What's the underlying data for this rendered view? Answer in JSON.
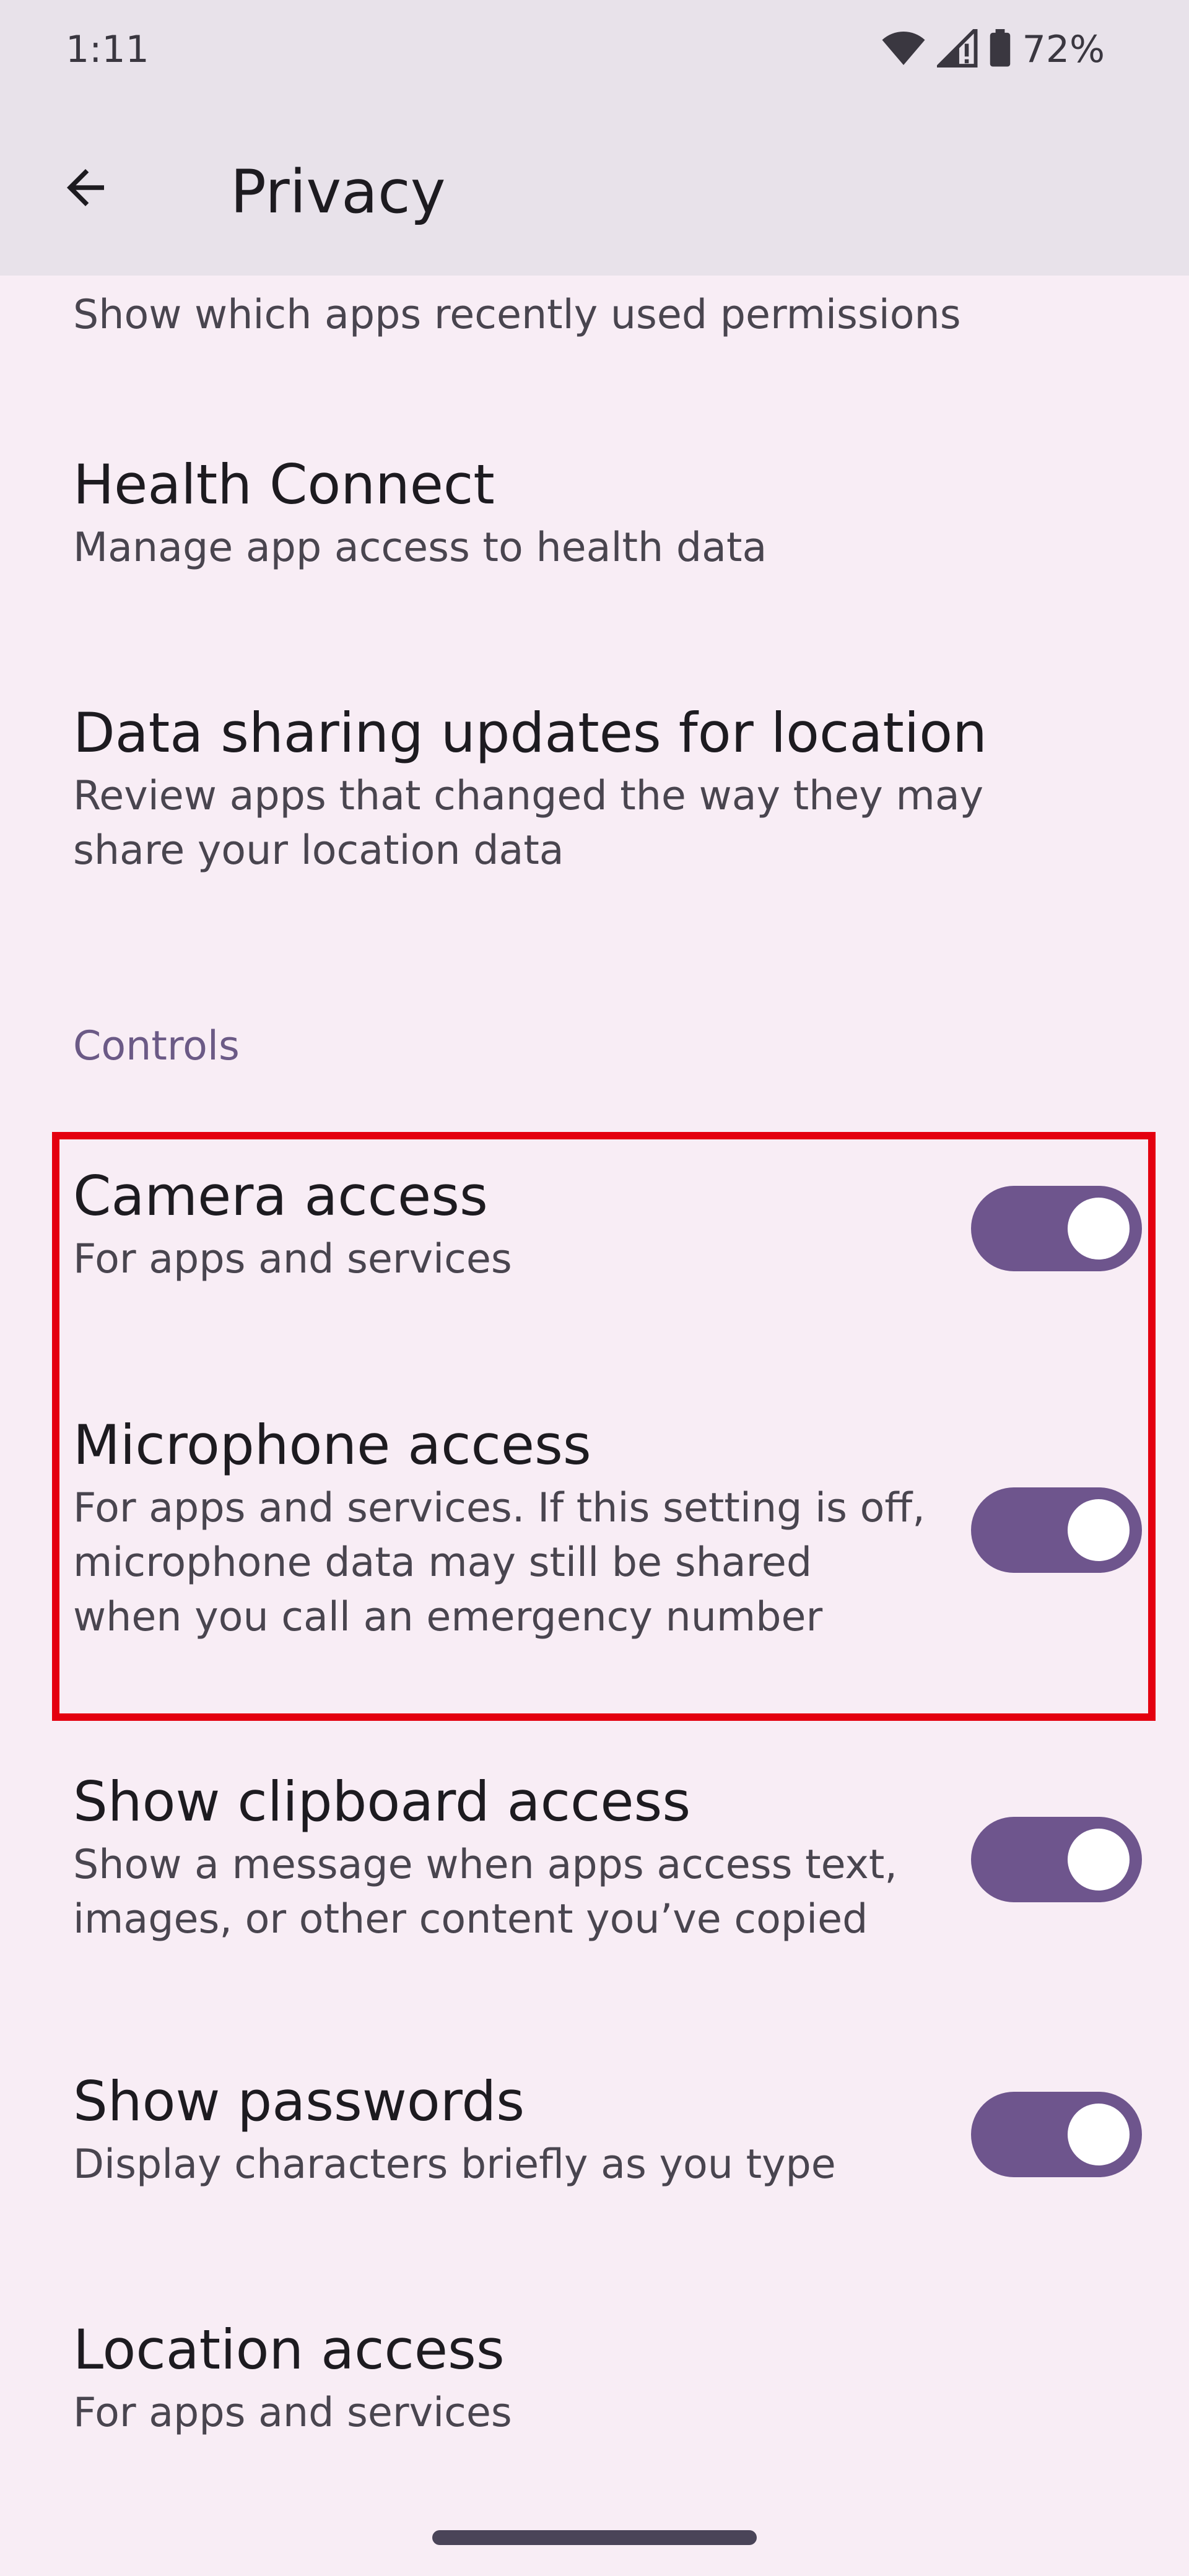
{
  "status_bar": {
    "time": "1:11",
    "battery_percent": "72%",
    "icons": [
      "wifi-icon",
      "cell-signal-icon",
      "battery-icon"
    ]
  },
  "app_bar": {
    "title": "Privacy",
    "back_icon": "arrow-back-icon"
  },
  "list": {
    "truncated_subtitle": "Show which apps recently used permissions",
    "health_connect": {
      "title": "Health Connect",
      "subtitle": "Manage app access to health data"
    },
    "data_sharing": {
      "title": "Data sharing updates for location",
      "subtitle": "Review apps that changed the way they may share your location data"
    },
    "controls_header": "Controls",
    "camera": {
      "title": "Camera access",
      "subtitle": "For apps and services",
      "enabled": true
    },
    "microphone": {
      "title": "Microphone access",
      "subtitle": "For apps and services. If this setting is off, microphone data may still be shared when you call an emergency number",
      "enabled": true
    },
    "clipboard": {
      "title": "Show clipboard access",
      "subtitle": "Show a message when apps access text, images, or other content you’ve copied",
      "enabled": true
    },
    "passwords": {
      "title": "Show passwords",
      "subtitle": "Display characters briefly as you type",
      "enabled": true
    },
    "location": {
      "title": "Location access",
      "subtitle": "For apps and services"
    }
  },
  "colors": {
    "background": "#f8edf5",
    "app_bar": "#e8e2ea",
    "toggle_on": "#6e558d",
    "section_header": "#6b5a86",
    "highlight": "#e4000f"
  }
}
